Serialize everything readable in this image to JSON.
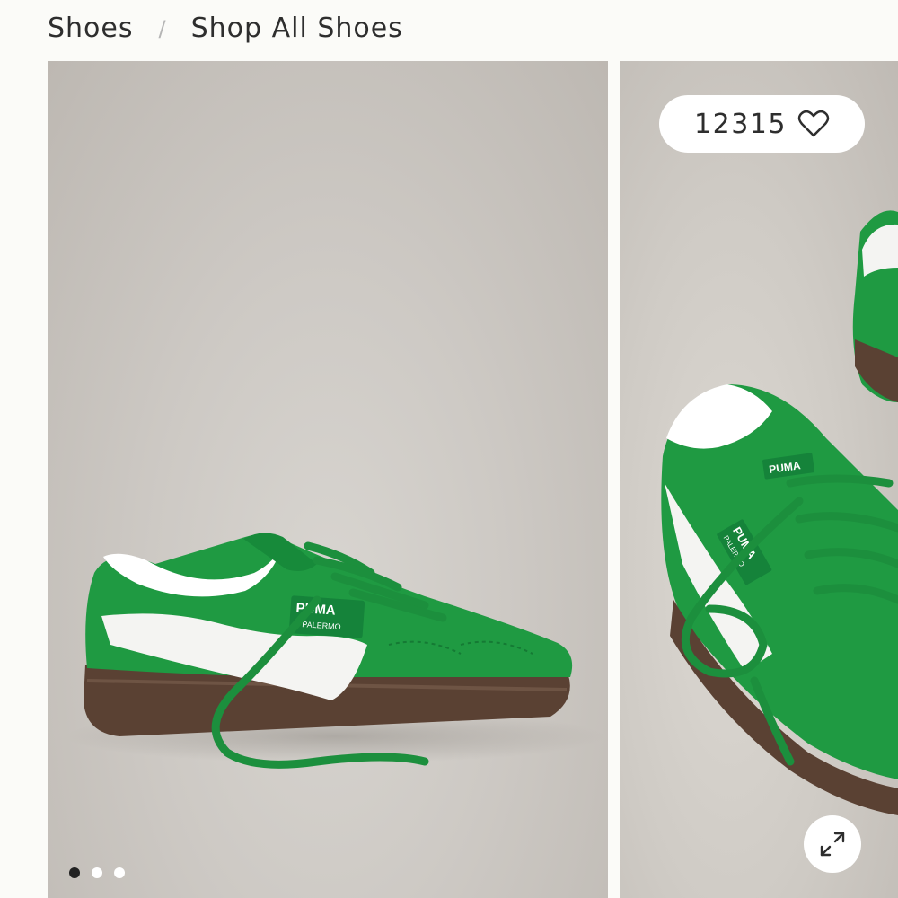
{
  "breadcrumb": {
    "items": [
      {
        "label": "Shoes"
      },
      {
        "label": "Shop All Shoes"
      }
    ],
    "separator": "/"
  },
  "gallery": {
    "favorite": {
      "count": "12315",
      "icon": "heart-icon"
    },
    "expand": {
      "icon": "expand-icon"
    },
    "dots": {
      "count": 3,
      "active_index": 0
    },
    "slides": [
      {
        "subject": "green suede sneaker side view",
        "brand_text": "PUMA",
        "model_text": "PALERMO"
      },
      {
        "subject": "green suede sneaker angled close-up",
        "brand_text": "PUMA",
        "model_text": "PALERMO"
      }
    ]
  },
  "colors": {
    "page_bg": "#fbfbf8",
    "text": "#2e2e2e",
    "shoe_green": "#1f9a42",
    "sole": "#5a4133",
    "photo_bg": "#cdc9c4"
  }
}
